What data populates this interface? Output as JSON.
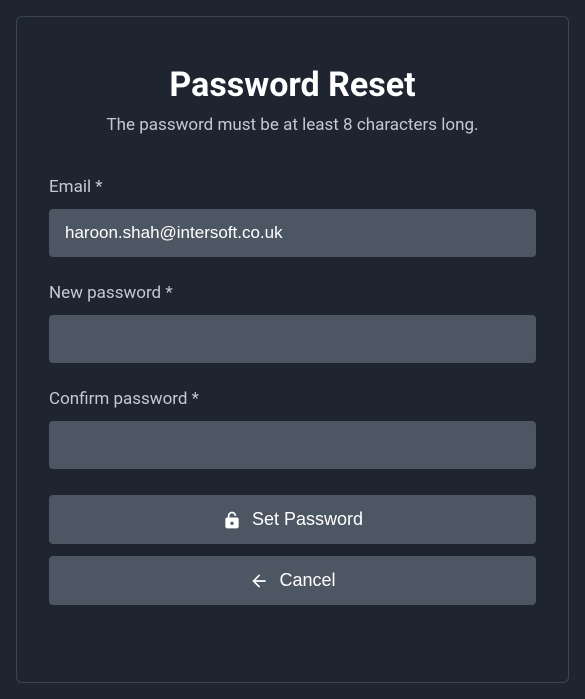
{
  "title": "Password Reset",
  "subtitle": "The password must be at least 8 characters long.",
  "fields": {
    "email": {
      "label": "Email *",
      "value": "haroon.shah@intersoft.co.uk"
    },
    "new_password": {
      "label": "New password *",
      "value": ""
    },
    "confirm_password": {
      "label": "Confirm password *",
      "value": ""
    }
  },
  "buttons": {
    "set_password": "Set Password",
    "cancel": "Cancel"
  }
}
